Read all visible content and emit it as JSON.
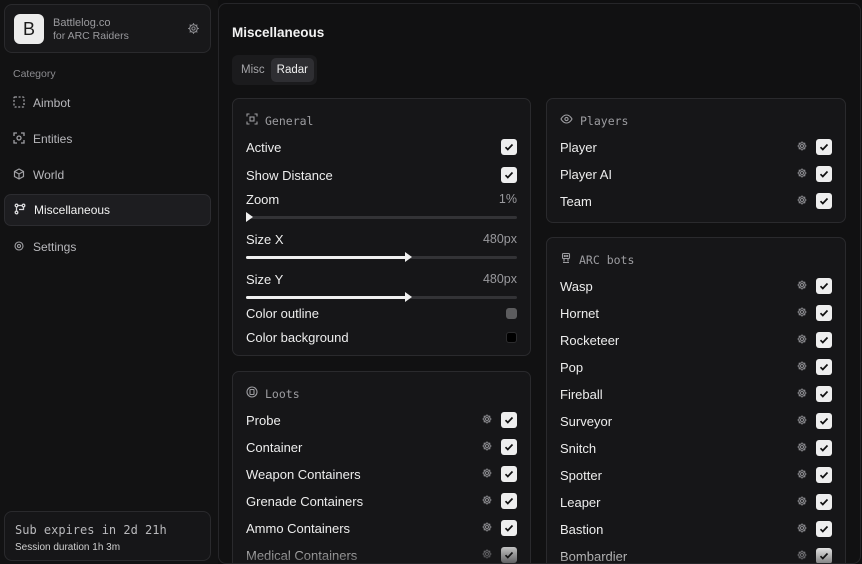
{
  "brand": {
    "logo_letter": "B",
    "name": "Battlelog.co",
    "subtitle": "for ARC Raiders"
  },
  "sidebar": {
    "category_label": "Category",
    "items": [
      {
        "label": "Aimbot",
        "icon": "crosshair-dashed-icon"
      },
      {
        "label": "Entities",
        "icon": "scan-face-icon"
      },
      {
        "label": "World",
        "icon": "cube-icon"
      },
      {
        "label": "Miscellaneous",
        "icon": "misc-grid-icon",
        "active": true
      },
      {
        "label": "Settings",
        "icon": "gear-icon"
      }
    ]
  },
  "session": {
    "expires": "Sub expires in 2d 21h",
    "duration": "Session duration 1h  3m"
  },
  "main": {
    "title": "Miscellaneous",
    "tabs": [
      {
        "label": "Misc"
      },
      {
        "label": "Radar",
        "active": true
      }
    ]
  },
  "general": {
    "title": "General",
    "active_label": "Active",
    "show_distance_label": "Show Distance",
    "zoom": {
      "label": "Zoom",
      "value_text": "1%",
      "fraction": 0.0
    },
    "size_x": {
      "label": "Size X",
      "value_text": "480px",
      "fraction": 0.6
    },
    "size_y": {
      "label": "Size Y",
      "value_text": "480px",
      "fraction": 0.6
    },
    "color_outline": {
      "label": "Color outline",
      "color": "#5c5c5e"
    },
    "color_background": {
      "label": "Color background",
      "color": "#000000"
    }
  },
  "loots": {
    "title": "Loots",
    "items": [
      "Probe",
      "Container",
      "Weapon Containers",
      "Grenade Containers",
      "Ammo Containers",
      "Medical Containers"
    ]
  },
  "players": {
    "title": "Players",
    "items": [
      "Player",
      "Player AI",
      "Team"
    ]
  },
  "arc_bots": {
    "title": "ARC bots",
    "items": [
      "Wasp",
      "Hornet",
      "Rocketeer",
      "Pop",
      "Fireball",
      "Surveyor",
      "Snitch",
      "Spotter",
      "Leaper",
      "Bastion",
      "Bombardier"
    ]
  }
}
